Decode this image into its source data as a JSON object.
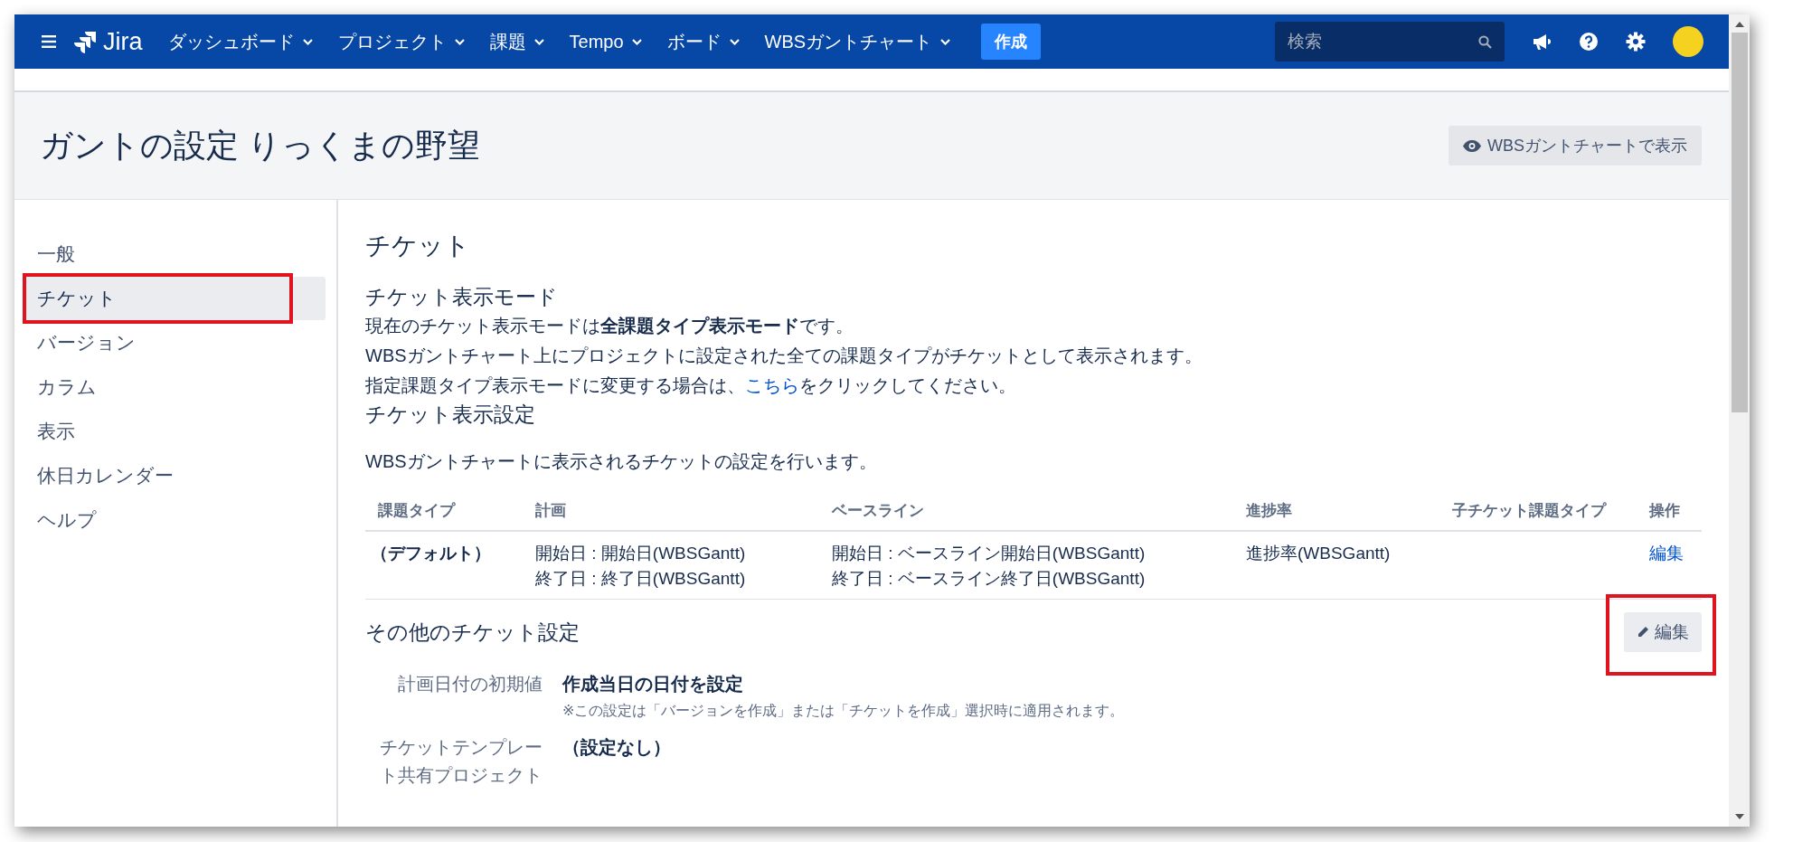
{
  "nav": {
    "logo": "Jira",
    "menus": [
      {
        "label": "ダッシュボード"
      },
      {
        "label": "プロジェクト"
      },
      {
        "label": "課題"
      },
      {
        "label": "Tempo"
      },
      {
        "label": "ボード"
      },
      {
        "label": "WBSガントチャート"
      }
    ],
    "create_button": "作成",
    "search": {
      "placeholder": "検索"
    }
  },
  "header": {
    "title": "ガントの設定 りっくまの野望",
    "view_button": "WBSガントチャートで表示"
  },
  "sidebar": {
    "items": [
      {
        "label": "一般",
        "selected": false,
        "highlighted": false
      },
      {
        "label": "チケット",
        "selected": true,
        "highlighted": true
      },
      {
        "label": "バージョン",
        "selected": false,
        "highlighted": false
      },
      {
        "label": "カラム",
        "selected": false,
        "highlighted": false
      },
      {
        "label": "表示",
        "selected": false,
        "highlighted": false
      },
      {
        "label": "休日カレンダー",
        "selected": false,
        "highlighted": false
      },
      {
        "label": "ヘルプ",
        "selected": false,
        "highlighted": false
      }
    ]
  },
  "content": {
    "title": "チケット",
    "mode_heading": "チケット表示モード",
    "mode_lines": [
      "現在のチケット表示モードは**全課題タイプ表示モード**です。",
      "WBSガントチャート上にプロジェクトに設定された全ての課題タイプがチケットとして表示されます。"
    ],
    "mode_change": {
      "before": "指定課題タイプ表示モードに変更する場合は、",
      "link": "こちら",
      "after": "をクリックしてください。"
    },
    "settings_heading": "チケット表示設定",
    "settings_description": "WBSガントチャートに表示されるチケットの設定を行います。",
    "table": {
      "columns": [
        "課題タイプ",
        "計画",
        "ベースライン",
        "進捗率",
        "子チケット課題タイプ",
        "操作"
      ],
      "rows": [
        {
          "issue_type": "（デフォルト）",
          "plan": [
            "開始日 : 開始日(WBSGantt)",
            "終了日 : 終了日(WBSGantt)"
          ],
          "baseline": [
            "開始日 : ベースライン開始日(WBSGantt)",
            "終了日 : ベースライン終了日(WBSGantt)"
          ],
          "progress": "進捗率(WBSGantt)",
          "action": "編集"
        }
      ]
    },
    "other": {
      "heading": "その他のチケット設定",
      "edit_button": {
        "label": "編集",
        "highlighted": true
      },
      "fields": [
        {
          "label": "計画日付の初期値",
          "value": "作成当日の日付を設定",
          "note": "※この設定は「バージョンを作成」または「チケットを作成」選択時に適用されます。"
        },
        {
          "label": "チケットテンプレート共有プロジェクト",
          "value": "（設定なし）"
        }
      ]
    }
  }
}
